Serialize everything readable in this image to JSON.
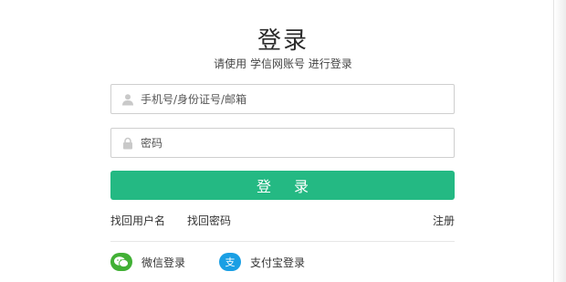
{
  "header": {
    "title": "登录",
    "subtitle": "请使用 学信网账号 进行登录"
  },
  "form": {
    "username_placeholder": "手机号/身份证号/邮箱",
    "username_value": "",
    "password_placeholder": "密码",
    "password_value": "",
    "login_label": "登 录"
  },
  "links": {
    "find_username": "找回用户名",
    "find_password": "找回密码",
    "register": "注册"
  },
  "social": {
    "wechat_label": "微信登录",
    "alipay_label": "支付宝登录"
  },
  "icons": {
    "username": "user-icon",
    "password": "lock-icon",
    "wechat": "wechat-icon",
    "alipay": "alipay-icon"
  },
  "colors": {
    "accent": "#24b983",
    "wechat": "#41b035",
    "alipay": "#1a9fe4"
  }
}
